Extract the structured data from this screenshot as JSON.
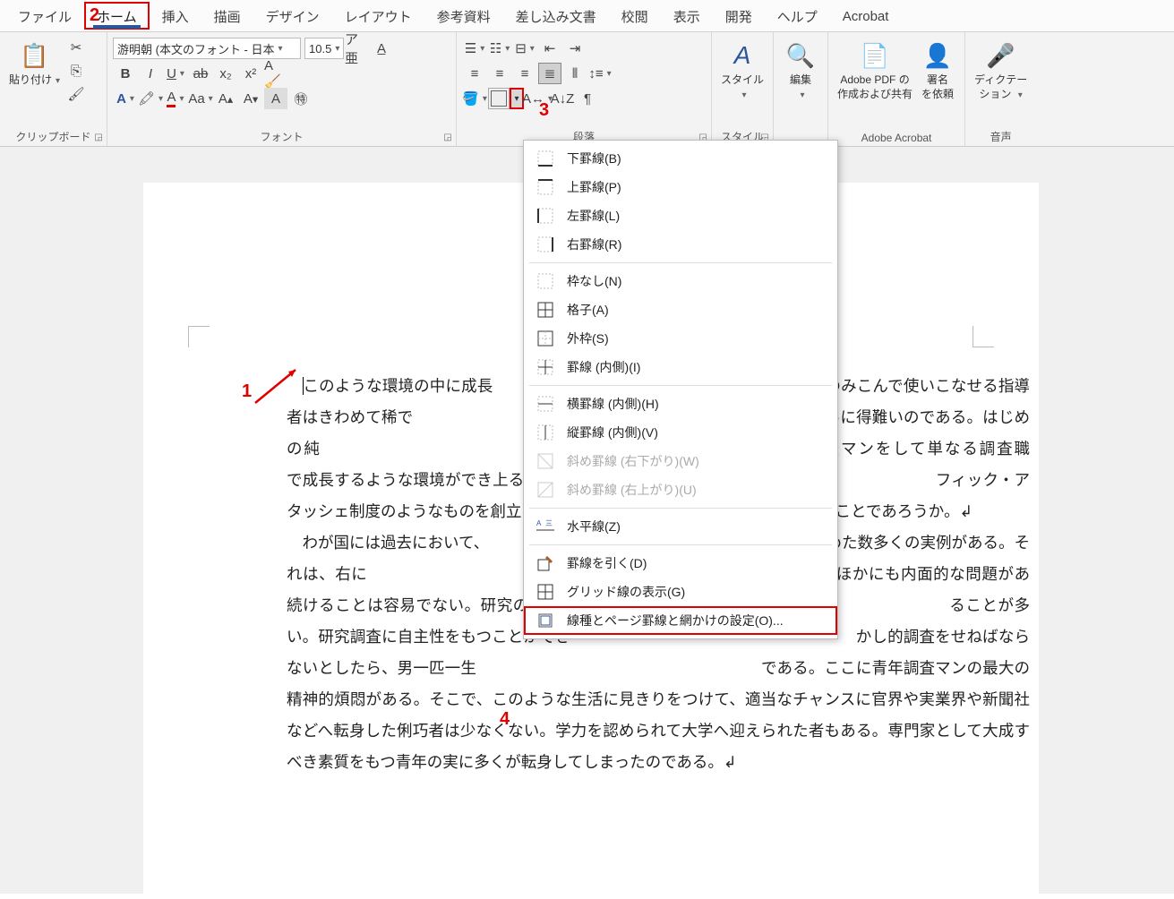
{
  "menu": {
    "file": "ファイル",
    "home": "ホーム",
    "insert": "挿入",
    "draw": "描画",
    "design": "デザイン",
    "layout": "レイアウト",
    "references": "参考資料",
    "mailings": "差し込み文書",
    "review": "校閲",
    "view": "表示",
    "developer": "開発",
    "help": "ヘルプ",
    "acrobat": "Acrobat"
  },
  "ribbon": {
    "clipboard": {
      "label": "クリップボード",
      "paste": "貼り付け"
    },
    "font": {
      "label": "フォント",
      "name": "游明朝 (本文のフォント - 日本",
      "size": "10.5"
    },
    "paragraph": {
      "label": "段落"
    },
    "styles": {
      "label": "スタイル",
      "button": "スタイル"
    },
    "editing": {
      "label": "編集",
      "button": "編集"
    },
    "acrobat": {
      "label": "Adobe Acrobat",
      "pdf": "Adobe PDF の\n作成および共有",
      "sign": "署名\nを依頼"
    },
    "voice": {
      "label": "音声",
      "dictate": "ディクテー\nション"
    }
  },
  "dropdown": {
    "bottom": "下罫線(B)",
    "top": "上罫線(P)",
    "left": "左罫線(L)",
    "right": "右罫線(R)",
    "none": "枠なし(N)",
    "all": "格子(A)",
    "outside": "外枠(S)",
    "inside": "罫線 (内側)(I)",
    "insideH": "横罫線 (内側)(H)",
    "insideV": "縦罫線 (内側)(V)",
    "diagDown": "斜め罫線 (右下がり)(W)",
    "diagUp": "斜め罫線 (右上がり)(U)",
    "hline": "水平線(Z)",
    "drawTable": "罫線を引く(D)",
    "viewGrid": "グリッド線の表示(G)",
    "settings": "線種とページ罫線と網かけの設定(O)..."
  },
  "annotations": {
    "n1": "1",
    "n2": "2",
    "n3": "3",
    "n4": "4"
  },
  "doc": {
    "p1": "このような環境の中に成長　　　　　　　　　　　　　　　　　　　里をのみこんで使いこなせる指導者はきわめて稀で　　　　　　　　　　　　　　　　　　ような人物は、容易に得難いのである。はじめの純　　　　　　　　　　　　　　　　　　こして殺してしまう。調査マンをして単なる調査職　　　　　　　　　　　　　　　　　　で成長するような環境ができ上ることを祈ってやま　　　　　　　　　　　　　　　　　　フィック・アタッシェ制度のようなものを創立する　　　　　　　　　　　　　　　　　　ことであろうか。↲",
    "p2": "わが国には過去において、　　　　　　　　　　　　　　　　　　断念せしめた数多くの実例がある。それは、右に　　　　　　　　　　　　　　　　　　きな原因であるが、そのほかにも内面的な問題があ　　　　　　　　　　　　　　　　　　続けることは容易でない。研究の方向や結論が与え　　　　　　　　　　　　　　　　　　ることが多い。研究調査に自主性をもつことができ　　　　　　　　　　　　　　　　　　かし的調査をせねばならないとしたら、男一匹一生　　　　　　　　　　　　　　　　　　である。ここに青年調査マンの最大の精神的煩悶がある。そこで、このような生活に見きりをつけて、適当なチャンスに官界や実業界や新聞社などへ転身した俐巧者は少なくない。学力を認められて大学へ迎えられた者もある。専門家として大成すべき素質をもつ青年の実に多くが転身してしまったのである。↲"
  }
}
